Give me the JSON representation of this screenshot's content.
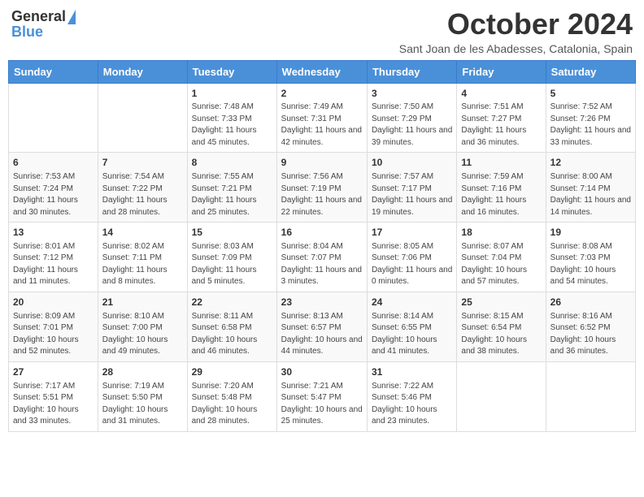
{
  "header": {
    "logo_general": "General",
    "logo_blue": "Blue",
    "month_year": "October 2024",
    "location": "Sant Joan de les Abadesses, Catalonia, Spain"
  },
  "days_of_week": [
    "Sunday",
    "Monday",
    "Tuesday",
    "Wednesday",
    "Thursday",
    "Friday",
    "Saturday"
  ],
  "weeks": [
    [
      {
        "day": "",
        "sunrise": "",
        "sunset": "",
        "daylight": ""
      },
      {
        "day": "",
        "sunrise": "",
        "sunset": "",
        "daylight": ""
      },
      {
        "day": "1",
        "sunrise": "Sunrise: 7:48 AM",
        "sunset": "Sunset: 7:33 PM",
        "daylight": "Daylight: 11 hours and 45 minutes."
      },
      {
        "day": "2",
        "sunrise": "Sunrise: 7:49 AM",
        "sunset": "Sunset: 7:31 PM",
        "daylight": "Daylight: 11 hours and 42 minutes."
      },
      {
        "day": "3",
        "sunrise": "Sunrise: 7:50 AM",
        "sunset": "Sunset: 7:29 PM",
        "daylight": "Daylight: 11 hours and 39 minutes."
      },
      {
        "day": "4",
        "sunrise": "Sunrise: 7:51 AM",
        "sunset": "Sunset: 7:27 PM",
        "daylight": "Daylight: 11 hours and 36 minutes."
      },
      {
        "day": "5",
        "sunrise": "Sunrise: 7:52 AM",
        "sunset": "Sunset: 7:26 PM",
        "daylight": "Daylight: 11 hours and 33 minutes."
      }
    ],
    [
      {
        "day": "6",
        "sunrise": "Sunrise: 7:53 AM",
        "sunset": "Sunset: 7:24 PM",
        "daylight": "Daylight: 11 hours and 30 minutes."
      },
      {
        "day": "7",
        "sunrise": "Sunrise: 7:54 AM",
        "sunset": "Sunset: 7:22 PM",
        "daylight": "Daylight: 11 hours and 28 minutes."
      },
      {
        "day": "8",
        "sunrise": "Sunrise: 7:55 AM",
        "sunset": "Sunset: 7:21 PM",
        "daylight": "Daylight: 11 hours and 25 minutes."
      },
      {
        "day": "9",
        "sunrise": "Sunrise: 7:56 AM",
        "sunset": "Sunset: 7:19 PM",
        "daylight": "Daylight: 11 hours and 22 minutes."
      },
      {
        "day": "10",
        "sunrise": "Sunrise: 7:57 AM",
        "sunset": "Sunset: 7:17 PM",
        "daylight": "Daylight: 11 hours and 19 minutes."
      },
      {
        "day": "11",
        "sunrise": "Sunrise: 7:59 AM",
        "sunset": "Sunset: 7:16 PM",
        "daylight": "Daylight: 11 hours and 16 minutes."
      },
      {
        "day": "12",
        "sunrise": "Sunrise: 8:00 AM",
        "sunset": "Sunset: 7:14 PM",
        "daylight": "Daylight: 11 hours and 14 minutes."
      }
    ],
    [
      {
        "day": "13",
        "sunrise": "Sunrise: 8:01 AM",
        "sunset": "Sunset: 7:12 PM",
        "daylight": "Daylight: 11 hours and 11 minutes."
      },
      {
        "day": "14",
        "sunrise": "Sunrise: 8:02 AM",
        "sunset": "Sunset: 7:11 PM",
        "daylight": "Daylight: 11 hours and 8 minutes."
      },
      {
        "day": "15",
        "sunrise": "Sunrise: 8:03 AM",
        "sunset": "Sunset: 7:09 PM",
        "daylight": "Daylight: 11 hours and 5 minutes."
      },
      {
        "day": "16",
        "sunrise": "Sunrise: 8:04 AM",
        "sunset": "Sunset: 7:07 PM",
        "daylight": "Daylight: 11 hours and 3 minutes."
      },
      {
        "day": "17",
        "sunrise": "Sunrise: 8:05 AM",
        "sunset": "Sunset: 7:06 PM",
        "daylight": "Daylight: 11 hours and 0 minutes."
      },
      {
        "day": "18",
        "sunrise": "Sunrise: 8:07 AM",
        "sunset": "Sunset: 7:04 PM",
        "daylight": "Daylight: 10 hours and 57 minutes."
      },
      {
        "day": "19",
        "sunrise": "Sunrise: 8:08 AM",
        "sunset": "Sunset: 7:03 PM",
        "daylight": "Daylight: 10 hours and 54 minutes."
      }
    ],
    [
      {
        "day": "20",
        "sunrise": "Sunrise: 8:09 AM",
        "sunset": "Sunset: 7:01 PM",
        "daylight": "Daylight: 10 hours and 52 minutes."
      },
      {
        "day": "21",
        "sunrise": "Sunrise: 8:10 AM",
        "sunset": "Sunset: 7:00 PM",
        "daylight": "Daylight: 10 hours and 49 minutes."
      },
      {
        "day": "22",
        "sunrise": "Sunrise: 8:11 AM",
        "sunset": "Sunset: 6:58 PM",
        "daylight": "Daylight: 10 hours and 46 minutes."
      },
      {
        "day": "23",
        "sunrise": "Sunrise: 8:13 AM",
        "sunset": "Sunset: 6:57 PM",
        "daylight": "Daylight: 10 hours and 44 minutes."
      },
      {
        "day": "24",
        "sunrise": "Sunrise: 8:14 AM",
        "sunset": "Sunset: 6:55 PM",
        "daylight": "Daylight: 10 hours and 41 minutes."
      },
      {
        "day": "25",
        "sunrise": "Sunrise: 8:15 AM",
        "sunset": "Sunset: 6:54 PM",
        "daylight": "Daylight: 10 hours and 38 minutes."
      },
      {
        "day": "26",
        "sunrise": "Sunrise: 8:16 AM",
        "sunset": "Sunset: 6:52 PM",
        "daylight": "Daylight: 10 hours and 36 minutes."
      }
    ],
    [
      {
        "day": "27",
        "sunrise": "Sunrise: 7:17 AM",
        "sunset": "Sunset: 5:51 PM",
        "daylight": "Daylight: 10 hours and 33 minutes."
      },
      {
        "day": "28",
        "sunrise": "Sunrise: 7:19 AM",
        "sunset": "Sunset: 5:50 PM",
        "daylight": "Daylight: 10 hours and 31 minutes."
      },
      {
        "day": "29",
        "sunrise": "Sunrise: 7:20 AM",
        "sunset": "Sunset: 5:48 PM",
        "daylight": "Daylight: 10 hours and 28 minutes."
      },
      {
        "day": "30",
        "sunrise": "Sunrise: 7:21 AM",
        "sunset": "Sunset: 5:47 PM",
        "daylight": "Daylight: 10 hours and 25 minutes."
      },
      {
        "day": "31",
        "sunrise": "Sunrise: 7:22 AM",
        "sunset": "Sunset: 5:46 PM",
        "daylight": "Daylight: 10 hours and 23 minutes."
      },
      {
        "day": "",
        "sunrise": "",
        "sunset": "",
        "daylight": ""
      },
      {
        "day": "",
        "sunrise": "",
        "sunset": "",
        "daylight": ""
      }
    ]
  ]
}
